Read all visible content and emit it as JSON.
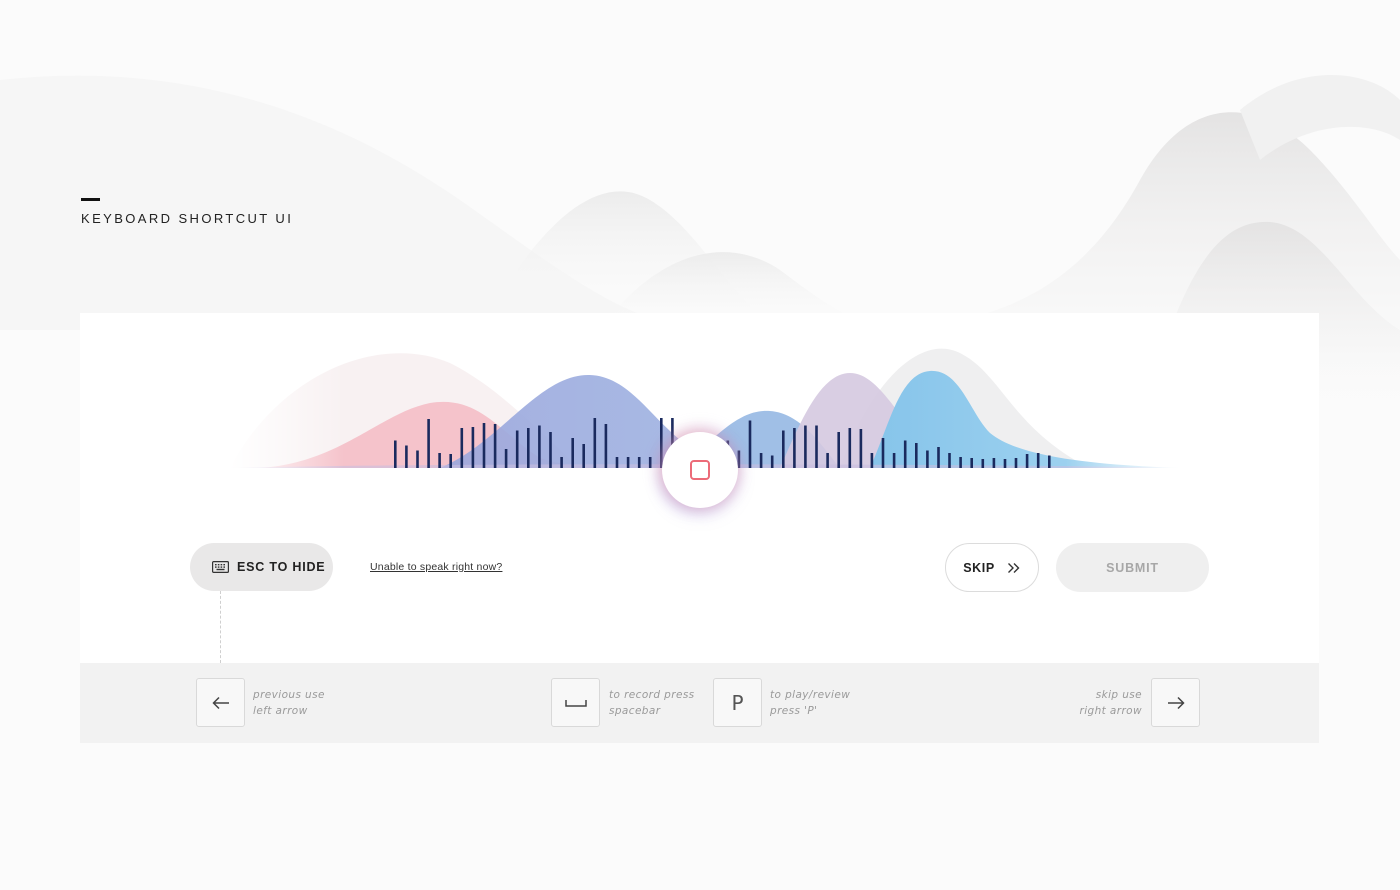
{
  "page": {
    "section_title": "KEYBOARD SHORTCUT UI"
  },
  "recorder": {
    "state": "recording",
    "stop_icon": "stop-square-icon",
    "accent_color": "#ec6b78",
    "waveform_bar_color": "#1a2a5e",
    "wave_colors": [
      "#f4b3bd",
      "#9aa6dc",
      "#7fbfe8",
      "#cdbfdc",
      "#e6e6e6"
    ],
    "waveform_levels": [
      0.55,
      0.45,
      0.35,
      0.98,
      0.3,
      0.28,
      0.8,
      0.82,
      0.9,
      0.88,
      0.38,
      0.75,
      0.8,
      0.85,
      0.72,
      0.22,
      0.6,
      0.48,
      1.0,
      0.88,
      0.22,
      0.22,
      0.22,
      0.22,
      1.0,
      1.0,
      0.25,
      0.22,
      0.25,
      0.22,
      0.55,
      0.35,
      0.95,
      0.3,
      0.25,
      0.75,
      0.8,
      0.85,
      0.85,
      0.3,
      0.72,
      0.8,
      0.78,
      0.3,
      0.6,
      0.3,
      0.55,
      0.5,
      0.35,
      0.42,
      0.3,
      0.22,
      0.2,
      0.18,
      0.2,
      0.18,
      0.2,
      0.28,
      0.3,
      0.25
    ]
  },
  "controls": {
    "esc_label": "ESC TO HIDE",
    "esc_icon": "keyboard-icon",
    "unable_link": "Unable to speak right now?",
    "skip_label": "SKIP",
    "skip_icon": "double-chevron-right-icon",
    "submit_label": "SUBMIT"
  },
  "shortcuts": {
    "previous": {
      "key_icon": "arrow-left-icon",
      "line1": "previous use",
      "line2": "left arrow"
    },
    "record": {
      "key_icon": "spacebar-icon",
      "line1": "to record press",
      "line2": "spacebar"
    },
    "play": {
      "key": "P",
      "line1": "to play/review",
      "line2": "press 'P'"
    },
    "skip": {
      "key_icon": "arrow-right-icon",
      "line1": "skip use",
      "line2": "right arrow"
    }
  }
}
